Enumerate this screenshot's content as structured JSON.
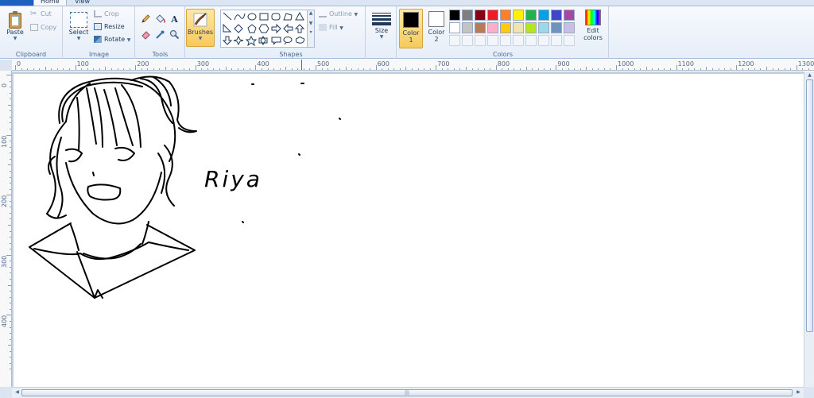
{
  "tabs": {
    "home": "Home",
    "view": "View"
  },
  "clipboard": {
    "group_label": "Clipboard",
    "paste": "Paste",
    "cut": "Cut",
    "copy": "Copy"
  },
  "image": {
    "group_label": "Image",
    "select": "Select",
    "crop": "Crop",
    "resize": "Resize",
    "rotate": "Rotate"
  },
  "tools": {
    "group_label": "Tools",
    "brushes": "Brushes"
  },
  "shapes": {
    "group_label": "Shapes",
    "outline": "Outline",
    "fill": "Fill"
  },
  "size": {
    "label": "Size"
  },
  "colors": {
    "group_label": "Colors",
    "color1": "Color 1",
    "color1_line1": "Color",
    "color1_line2": "1",
    "color2_line1": "Color",
    "color2_line2": "2",
    "color1_value": "#000000",
    "color2_value": "#ffffff",
    "edit_line1": "Edit",
    "edit_line2": "colors",
    "palette_row1": [
      "#000000",
      "#7f7f7f",
      "#880015",
      "#ed1c24",
      "#ff7f27",
      "#fff200",
      "#22b14c",
      "#00a2e8",
      "#3f48cc",
      "#a349a4"
    ],
    "palette_row2": [
      "#ffffff",
      "#c3c3c3",
      "#b97a57",
      "#ffaec9",
      "#ffc90e",
      "#efe4b0",
      "#b5e61d",
      "#99d9ea",
      "#7092be",
      "#c8bfe7"
    ]
  },
  "ruler": {
    "h_labels": [
      "0",
      "100",
      "200",
      "300",
      "400",
      "500",
      "600",
      "700",
      "800",
      "900",
      "1000",
      "1100",
      "1200",
      "1300"
    ],
    "v_labels": [
      "0",
      "100",
      "200",
      "300",
      "400"
    ]
  },
  "canvas": {
    "handwritten_text": "Riya"
  }
}
